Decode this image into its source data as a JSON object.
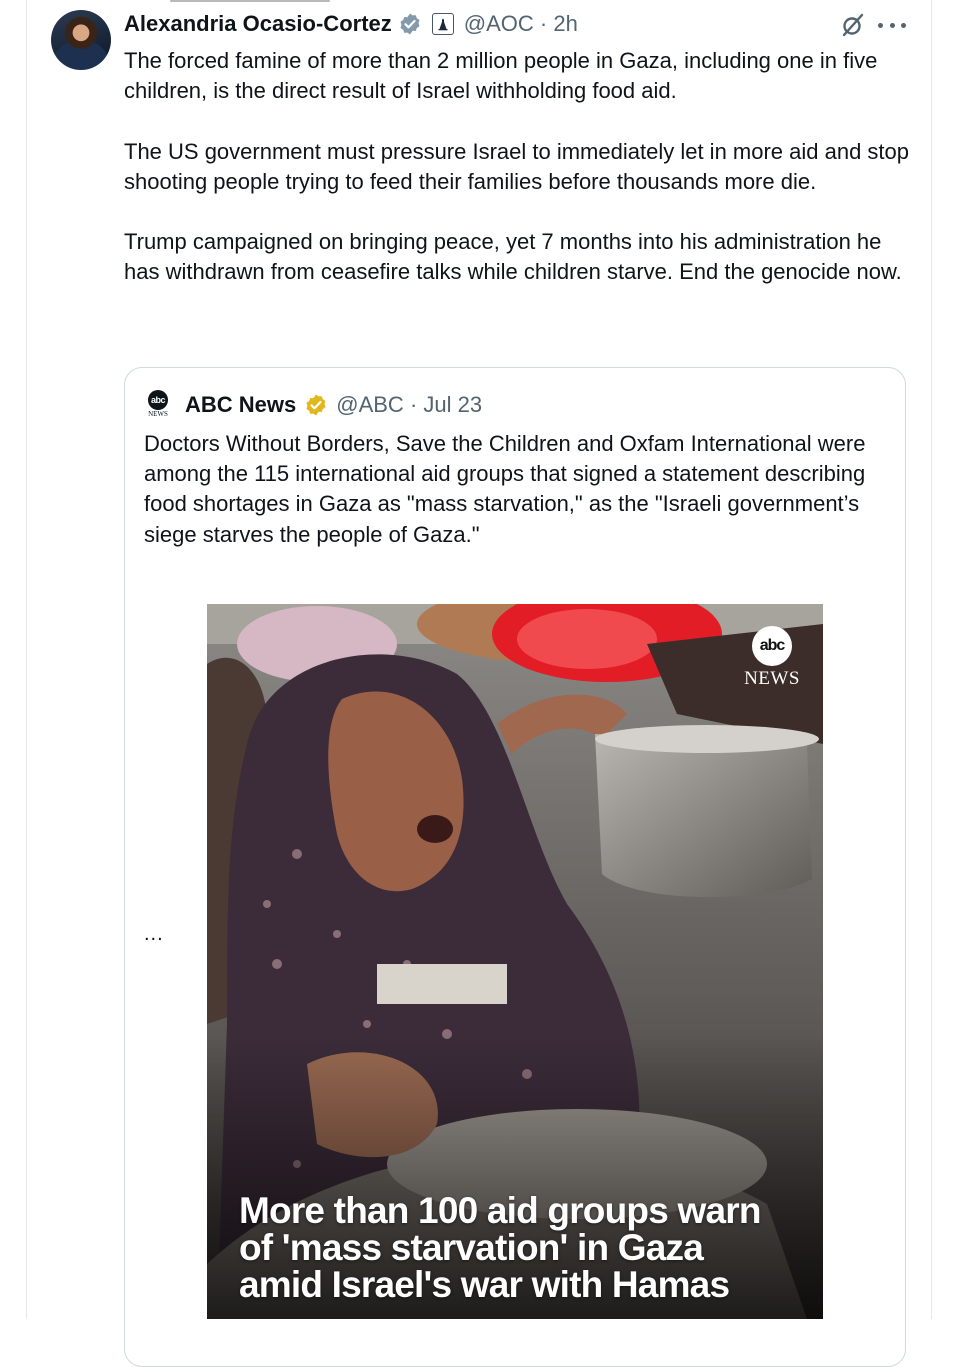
{
  "tweet": {
    "author_name": "Alexandria Ocasio-Cortez",
    "handle": "@AOC",
    "time": "2h",
    "paragraphs": [
      "The forced famine of more than 2 million people in Gaza, including one in five children, is the direct result of Israel withholding food aid.",
      "The US government must pressure Israel to immediately let in more aid and stop shooting people trying to feed their families before thousands more die.",
      "Trump campaigned on bringing peace, yet 7 months into his administration he has withdrawn from ceasefire talks while children starve. End the genocide now."
    ]
  },
  "quote": {
    "logo_text": "abc",
    "logo_sub": "NEWS",
    "author_name": "ABC News",
    "handle": "@ABC",
    "date": "Jul 23",
    "text": "Doctors Without Borders, Save the Children and Oxfam International were among the 115 international aid groups that signed a statement describing food shortages in Gaza as \"mass starvation,\" as the \"Israeli government’s siege starves the people of Gaza.\"",
    "more": "..."
  },
  "media": {
    "watermark_logo": "abc",
    "watermark_text": "NEWS",
    "headline_lines": [
      "More than 100 aid groups warn",
      "of 'mass starvation' in Gaza",
      "amid Israel's war with Hamas"
    ]
  },
  "icons": {
    "verified": "verified-badge-icon",
    "gov": "government-badge-icon",
    "grok": "grok-icon",
    "more": "more-options-icon",
    "quote_verified": "gold-verified-badge-icon"
  },
  "colors": {
    "text": "#0f1419",
    "muted": "#536471",
    "border": "#cfd9de",
    "verified_blue": "#829aab",
    "verified_gold": "#e2b719"
  }
}
